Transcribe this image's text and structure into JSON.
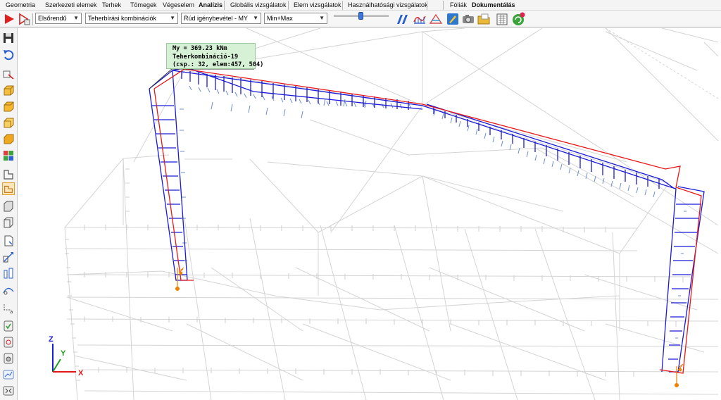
{
  "menu": {
    "tabs": [
      {
        "label": "Geometria",
        "active": false
      },
      {
        "label": "Szerkezeti elemek",
        "active": false
      },
      {
        "label": "Terhek",
        "active": false
      },
      {
        "label": "Tömegek",
        "active": false
      },
      {
        "label": "Végeselem",
        "active": false
      },
      {
        "label": "Analízis",
        "active": true
      },
      {
        "label": "Globális vizsgálatok",
        "active": false
      },
      {
        "label": "Elem vizsgálatok",
        "active": false
      },
      {
        "label": "Használhatósági vizsgálatok",
        "active": false
      }
    ],
    "right_tabs": [
      {
        "label": "Fóliák",
        "active": false
      },
      {
        "label": "Dokumentálás",
        "active": true
      }
    ]
  },
  "toolbar": {
    "combo_order": "Elsőrendű",
    "combo_combination": "Teherbírási kombinációk",
    "combo_result": "Rúd igénybevétel - MY",
    "combo_envelope": "Min+Max",
    "slider_level": 0.5
  },
  "tooltip": {
    "line1": "My = 369.23 kNm",
    "line2": "Teherkombináció-19",
    "line3": "(csp.: 32, elem:457, 504)"
  },
  "axes": {
    "z": "Z",
    "y": "Y",
    "x": "X"
  },
  "colors": {
    "moment_positive": "#e81818",
    "moment_diagram": "#1a1ad8",
    "grid": "#d6d6d6",
    "support": "#f08000",
    "load": "#5577cc"
  },
  "sidebar_icons": [
    "save-icon",
    "undo-icon",
    "view-icon",
    "box-front-icon",
    "box-top-icon",
    "box-side-icon",
    "box-iso-icon",
    "color-grid-icon",
    "frame-icon",
    "frame-selected-icon",
    "frame-3d-icon",
    "frame-edit-icon",
    "document-icon",
    "dimension-icon",
    "section-icon",
    "measure-icon",
    "node-icon",
    "check-icon",
    "result-table-icon",
    "camera-icon",
    "chart-icon",
    "zoom-fit-icon"
  ]
}
